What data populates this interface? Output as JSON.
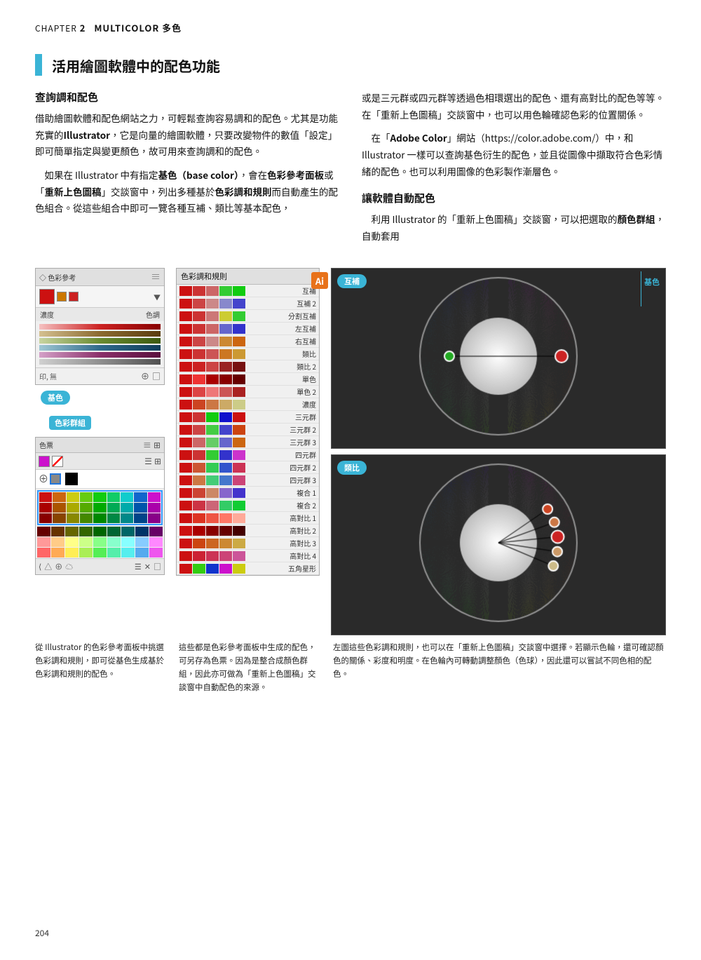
{
  "chapter": {
    "label": "CHAPTER",
    "number": "2",
    "title": "MULTICOLOR 多色"
  },
  "main_section": {
    "title": "活用繪圖軟體中的配色功能",
    "left_col": {
      "subsection1": {
        "title": "查詢調和配色",
        "paragraphs": [
          "借助繪圖軟體和配色網站之力，可輕鬆查詢容易調和的配色。尤其是功能充實的 Illustrator，它是向量的繪圖軟體，只要改變物件的數值「設定」即可簡單指定與變更顏色，故可用來查詢調和的配色。",
          "如果在 Illustrator 中有指定基色（base color），會在色彩參考面板或「重新上色圖稿」交談窗中，列出多種基於色彩調和規則而自動產生的配色組合。從這些組合中即可一覽各種互補、類比等基本配色，"
        ]
      }
    },
    "right_col": {
      "paragraphs": [
        "或是三元群或四元群等透過色相環選出的配色、還有高對比的配色等等。在「重新上色圖稿」交談窗中，也可以用色輪確認色彩的位置關係。",
        "在「Adobe Color」網站（https://color.adobe.com/）中，和 Illustrator 一樣可以查詢基色衍生的配色，並且從圖像中擷取符合色彩情緒的配色。也可以利用圖像的色彩製作漸層色。"
      ],
      "subsection2": {
        "title": "讓軟體自動配色",
        "paragraph": "利用 Illustrator 的「重新上色圖稿」交談窗，可以把選取的顏色群組，自動套用"
      }
    }
  },
  "color_ref_panel": {
    "title": "◇ 色彩參考",
    "dots": "≡",
    "swatches": {
      "big_color": "#cc1111",
      "small_colors": [
        "#cc8800",
        "#cc1111"
      ]
    },
    "labels": [
      "濃度",
      "色調"
    ],
    "gradient_bars": [
      {
        "colors": [
          "#f5c0c0",
          "#cc2222",
          "#880000"
        ]
      },
      {
        "colors": [
          "#d4c0a0",
          "#8b6a30",
          "#5a3d10"
        ]
      },
      {
        "colors": [
          "#c0d4a0",
          "#6a8b30",
          "#3d5a10"
        ]
      },
      {
        "colors": [
          "#a0c0d4",
          "#306a8b",
          "#103d5a"
        ]
      },
      {
        "colors": [
          "#d4a0c0",
          "#8b306a",
          "#5a103d"
        ]
      },
      {
        "colors": [
          "#c8c8c8",
          "#888888",
          "#444444"
        ]
      }
    ],
    "bottom": {
      "label": "印,無",
      "icons": [
        "⊕",
        "□"
      ]
    }
  },
  "badge_kiso": "基色",
  "badge_shikisai_group": "色彩群組",
  "swatches_panel": {
    "title": "色票",
    "dots": "≡",
    "grid_colors": [
      "#888888",
      "#dddddd",
      "#ffff00",
      "#ff8800",
      "#ff0000",
      "#ff00ff",
      "#0000ff",
      "#00ffff",
      "#00ff00",
      "#666666",
      "#cccc00",
      "#cc6600",
      "#cc0000",
      "#cc00cc",
      "#0000cc",
      "#00cccc",
      "#00cc00",
      "#888800",
      "#444444",
      "#999900",
      "#995500",
      "#990000",
      "#990099",
      "#000099",
      "#009999",
      "#009900",
      "#665500",
      "#222222",
      "#888844",
      "#664400",
      "#660000",
      "#660066",
      "#000066",
      "#006666",
      "#006600",
      "#443300",
      "#111111",
      "#554422",
      "#553300",
      "#440000",
      "#440044",
      "#000044",
      "#004444",
      "#004400",
      "#221100",
      "#ff9999",
      "#ffcc66",
      "#ffff66",
      "#ccff66",
      "#66ff66",
      "#66ffcc",
      "#66ccff",
      "#9999ff",
      "#ff66cc",
      "#ff6666",
      "#ffaa33",
      "#ffee33",
      "#aaee33",
      "#33ee33",
      "#33eeaa",
      "#33aaee",
      "#6666ee",
      "#ee33aa",
      "#cc3333",
      "#cc7711",
      "#cccc11",
      "#88cc11",
      "#11cc11",
      "#11cc88",
      "#1188cc",
      "#3333cc",
      "#cc1188"
    ]
  },
  "harmony_panel": {
    "title": "色彩調和規則",
    "rules": [
      {
        "label": "互補",
        "colors": [
          "#cc1111",
          "#cc3333",
          "#cc6666",
          "#33cc33",
          "#11cc11"
        ]
      },
      {
        "label": "互補 2",
        "colors": [
          "#cc1111",
          "#cc4444",
          "#cc8888",
          "#8888cc",
          "#4444cc"
        ]
      },
      {
        "label": "分割互補",
        "colors": [
          "#cc1111",
          "#cc3333",
          "#cc7777",
          "#cccc33",
          "#33cc33"
        ]
      },
      {
        "label": "左互補",
        "colors": [
          "#cc1111",
          "#cc3333",
          "#cc6666",
          "#6666cc",
          "#3333cc"
        ]
      },
      {
        "label": "右互補",
        "colors": [
          "#cc1111",
          "#cc4444",
          "#cc8888",
          "#cc8833",
          "#cc6611"
        ]
      },
      {
        "label": "類比",
        "colors": [
          "#cc1111",
          "#cc3333",
          "#cc5555",
          "#cc7722",
          "#cc9933"
        ]
      },
      {
        "label": "類比 2",
        "colors": [
          "#cc1111",
          "#cc2222",
          "#cc4444",
          "#992222",
          "#771111"
        ]
      },
      {
        "label": "單色",
        "colors": [
          "#cc1111",
          "#ee3333",
          "#aa0000",
          "#880000",
          "#660000"
        ]
      },
      {
        "label": "單色 2",
        "colors": [
          "#cc1111",
          "#dd4444",
          "#ee7777",
          "#cc5555",
          "#aa2222"
        ]
      },
      {
        "label": "濃度",
        "colors": [
          "#cc1111",
          "#cc4422",
          "#cc7744",
          "#ccaa66",
          "#cccc88"
        ]
      },
      {
        "label": "三元群",
        "colors": [
          "#cc1111",
          "#cc3333",
          "#11cc11",
          "#1111cc",
          "#cc1111"
        ]
      },
      {
        "label": "三元群 2",
        "colors": [
          "#cc1111",
          "#cc4444",
          "#44cc44",
          "#4444cc",
          "#cc4411"
        ]
      },
      {
        "label": "三元群 3",
        "colors": [
          "#cc1111",
          "#cc6666",
          "#66cc66",
          "#6666cc",
          "#cc6611"
        ]
      },
      {
        "label": "四元群",
        "colors": [
          "#cc1111",
          "#cc3333",
          "#33cc33",
          "#3333cc",
          "#cc33cc"
        ]
      },
      {
        "label": "四元群 2",
        "colors": [
          "#cc1111",
          "#cc5533",
          "#33cc55",
          "#3355cc",
          "#cc3355"
        ]
      },
      {
        "label": "四元群 3",
        "colors": [
          "#cc1111",
          "#cc7744",
          "#44cc77",
          "#4477cc",
          "#cc4477"
        ]
      },
      {
        "label": "複合 1",
        "colors": [
          "#cc1111",
          "#cc4433",
          "#cc8866",
          "#8866cc",
          "#4433cc"
        ]
      },
      {
        "label": "複合 2",
        "colors": [
          "#cc1111",
          "#cc3344",
          "#cc6677",
          "#33cc66",
          "#11cc33"
        ]
      },
      {
        "label": "高對比 1",
        "colors": [
          "#cc1111",
          "#dd3322",
          "#ee5544",
          "#ff7766",
          "#ffaa99"
        ]
      },
      {
        "label": "高對比 2",
        "colors": [
          "#cc1111",
          "#aa0000",
          "#880000",
          "#660000",
          "#440000"
        ]
      },
      {
        "label": "高對比 3",
        "colors": [
          "#cc1111",
          "#cc4411",
          "#cc6622",
          "#cc8833",
          "#ccaa44"
        ]
      },
      {
        "label": "高對比 4",
        "colors": [
          "#cc1111",
          "#cc2233",
          "#cc3355",
          "#cc4477",
          "#cc5599"
        ]
      },
      {
        "label": "五角星形",
        "colors": [
          "#cc1111",
          "#33cc11",
          "#1133cc",
          "#cc11cc",
          "#cccc11"
        ]
      }
    ]
  },
  "wheel_complementary": {
    "badge": "互補",
    "badge_kiso": "基色"
  },
  "wheel_analogous": {
    "badge": "類比"
  },
  "caption_left": "從 Illustrator 的色彩參考面板中挑選色彩調和規則，即可從基色生成基於色彩調和規則的配色。",
  "caption_middle": "這些都是色彩參考面板中生成的配色，可另存為色票。因為是整合成顏色群組，因此亦可做為「重新上色圖稿」交談窗中自動配色的來源。",
  "caption_right": "左圖這些色彩調和規則，也可以在「重新上色圖稿」交談窗中選擇。若顯示色輪，還可確認顏色的關係、彩度和明度。在色輪內可轉動調整顏色（色球），因此還可以嘗試不同色相的配色。",
  "page_number": "204"
}
